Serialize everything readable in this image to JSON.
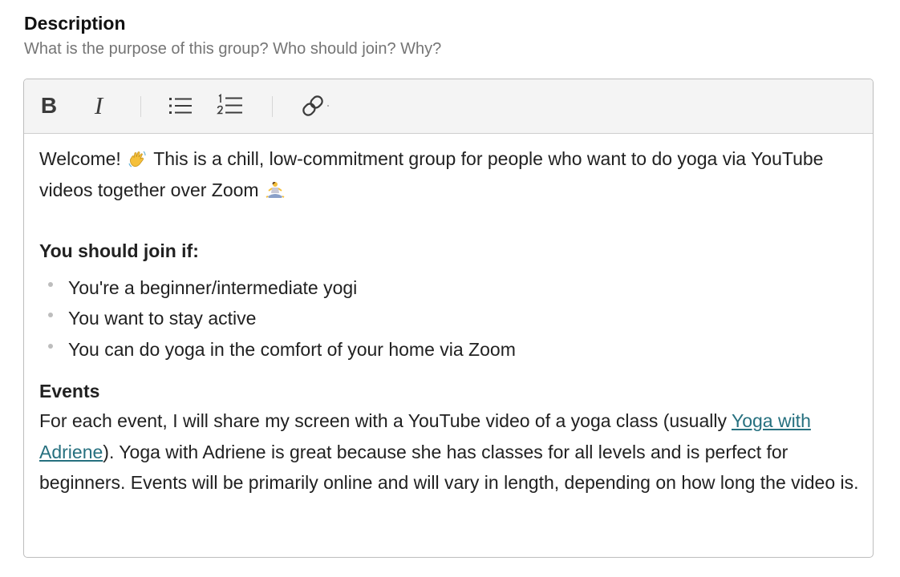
{
  "field": {
    "title": "Description",
    "help": "What is the purpose of this group? Who should join? Why?"
  },
  "toolbar": {
    "bold_icon": "B",
    "italic_icon": "I",
    "buttons": [
      "bold-icon",
      "italic-icon",
      "bullet-list-icon",
      "numbered-list-icon",
      "link-icon"
    ]
  },
  "content": {
    "intro_before_emoji": "Welcome!",
    "intro_middle": "This is a chill, low-commitment group for people who want to do yoga via YouTube videos together over Zoom",
    "wave_emoji": "waving-hand-emoji",
    "yoga_emoji": "person-in-lotus-position-emoji",
    "join_heading": "You should join if:",
    "bullets": [
      "You're a beginner/intermediate yogi",
      "You want to stay active",
      "You can do yoga in the comfort of your home via Zoom"
    ],
    "events_heading": "Events",
    "events_before_link": "For each event, I will share my screen with a YouTube video of a yoga class (usually",
    "events_link": "Yoga with Adriene",
    "events_after_link": "). Yoga with Adriene is great because she has classes for all levels and is perfect for beginners. Events will be primarily online and will vary in length, depending on how long the video is."
  },
  "colors": {
    "link": "#26707f",
    "toolbar_bg": "#f4f4f4",
    "border": "#bdbdbd",
    "help_text": "#757575"
  }
}
